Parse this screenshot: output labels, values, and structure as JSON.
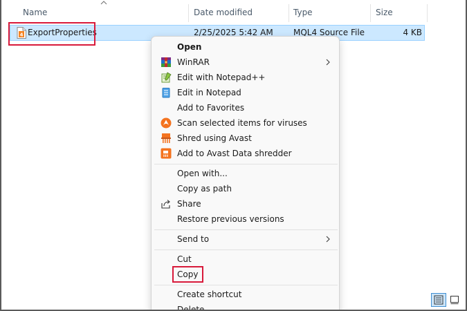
{
  "columns": {
    "name": "Name",
    "date_modified": "Date modified",
    "type": "Type",
    "size": "Size"
  },
  "file": {
    "name": "ExportProperties",
    "date_modified": "2/25/2025 5:42 AM",
    "type": "MQL4 Source File",
    "size": "4 KB",
    "icon": "mql4-file-icon"
  },
  "context_menu": {
    "open": "Open",
    "winrar": "WinRAR",
    "edit_notepadpp": "Edit with Notepad++",
    "edit_notepad": "Edit in Notepad",
    "add_favorites": "Add to Favorites",
    "scan_viruses": "Scan selected items for viruses",
    "shred_avast": "Shred using Avast",
    "add_avast_shredder": "Add to Avast Data shredder",
    "open_with": "Open with...",
    "copy_as_path": "Copy as path",
    "share": "Share",
    "restore_versions": "Restore previous versions",
    "send_to": "Send to",
    "cut": "Cut",
    "copy": "Copy",
    "create_shortcut": "Create shortcut",
    "delete": "Delete"
  },
  "colors": {
    "selection": "#cce8ff",
    "highlight_box": "#d8193a",
    "avast_orange": "#f4731f"
  }
}
